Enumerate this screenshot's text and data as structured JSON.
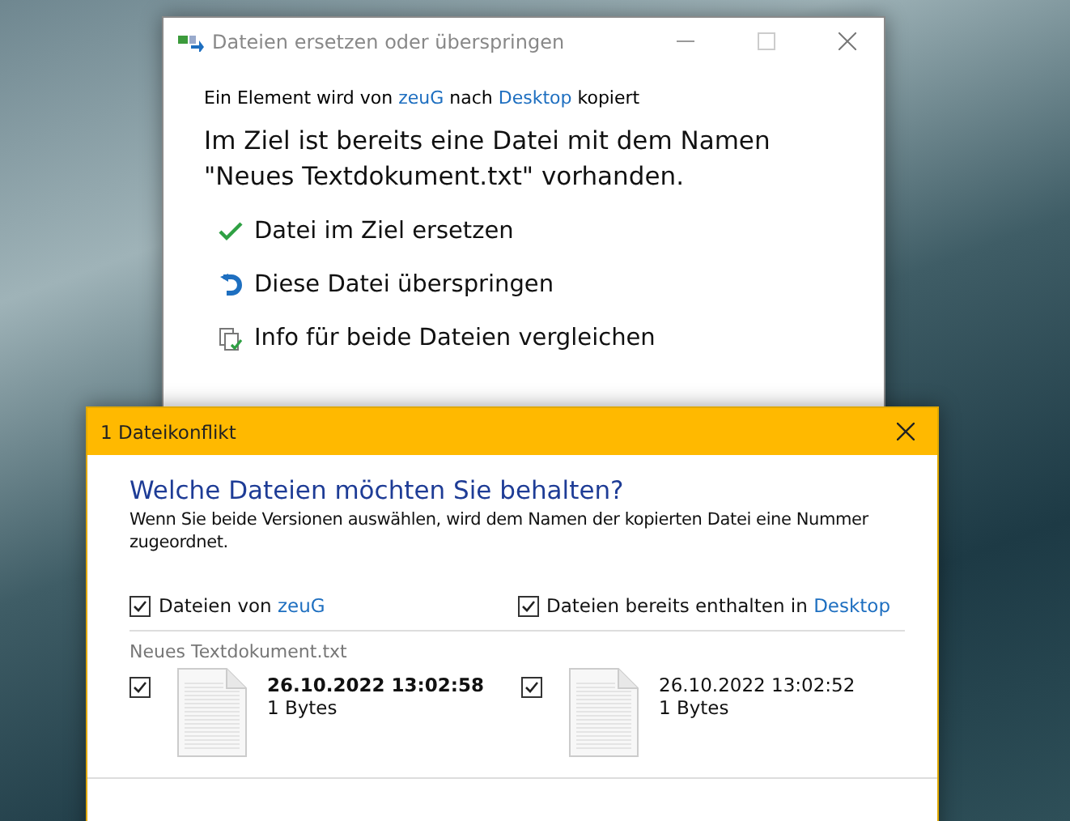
{
  "replace_window": {
    "title": "Dateien ersetzen oder überspringen",
    "status": {
      "before": "Ein Element wird von",
      "source": "zeuG",
      "middle": "nach",
      "target": "Desktop",
      "after": "kopiert"
    },
    "message": "Im Ziel ist bereits eine Datei mit dem Namen \"Neues Textdokument.txt\" vorhanden.",
    "options": [
      {
        "kind": "replace",
        "label": "Datei im Ziel ersetzen"
      },
      {
        "kind": "skip",
        "label": "Diese Datei überspringen"
      },
      {
        "kind": "compare",
        "label": "Info für beide Dateien vergleichen"
      }
    ]
  },
  "conflict_window": {
    "title": "1 Dateikonflikt",
    "heading": "Welche Dateien möchten Sie behalten?",
    "description": "Wenn Sie beide Versionen auswählen, wird dem Namen der kopierten Datei eine Nummer zugeordnet.",
    "columns": [
      {
        "label": "Dateien von",
        "location": "zeuG",
        "checked": true
      },
      {
        "label": "Dateien bereits enthalten in",
        "location": "Desktop",
        "checked": true
      }
    ],
    "file_name": "Neues Textdokument.txt",
    "versions": [
      {
        "date": "26.10.2022 13:02:58",
        "size": "1 Bytes",
        "checked": true,
        "newer": true
      },
      {
        "date": "26.10.2022 13:02:52",
        "size": "1 Bytes",
        "checked": true,
        "newer": false
      }
    ]
  }
}
